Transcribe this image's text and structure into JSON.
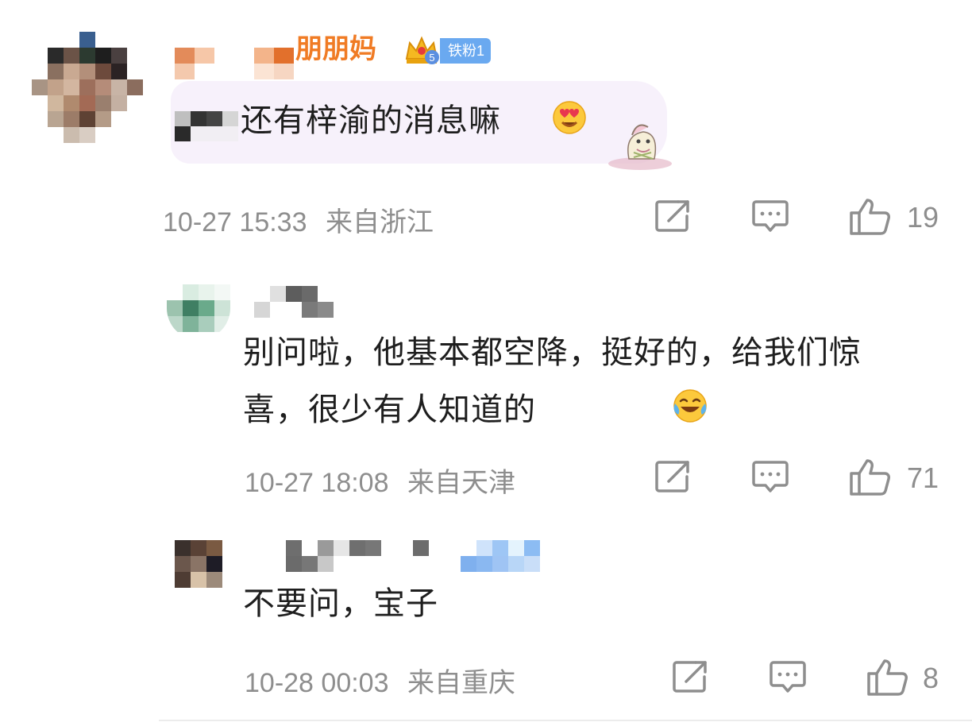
{
  "comments": [
    {
      "username_visible": "朋朋妈",
      "badge_label": "铁粉1",
      "badge_level": "5",
      "text": "还有梓渝的消息嘛",
      "emoji": "heart-eyes-emoji",
      "time": "10-27 15:33",
      "location": "来自浙江",
      "likes": "19"
    },
    {
      "text": "别问啦，他基本都空降，挺好的，给我们惊喜，很少有人知道的",
      "emoji": "laugh-cry-emoji",
      "time": "10-27 18:08",
      "location": "来自天津",
      "likes": "71"
    },
    {
      "text": "不要问，宝子",
      "time": "10-28 00:03",
      "location": "来自重庆",
      "likes": "8"
    }
  ],
  "icons": {
    "repost": "share-edit-icon",
    "reply": "comment-icon",
    "like": "thumbs-up-icon"
  },
  "colors": {
    "username": "#f07b24",
    "badge": "#6aa9f0",
    "meta": "#8e8e8e",
    "bubble": "#f7f1fb"
  }
}
